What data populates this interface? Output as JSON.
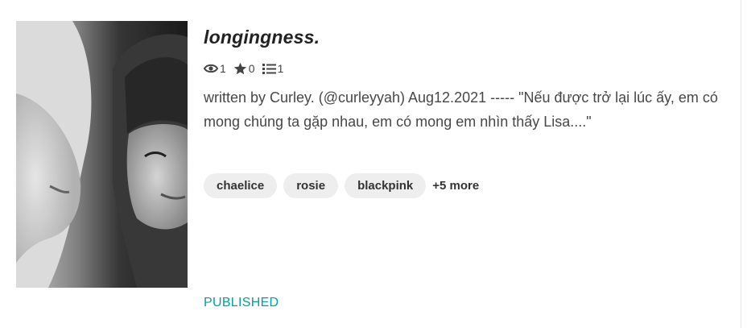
{
  "story": {
    "title": "longingness.",
    "stats": {
      "views": "1",
      "votes": "0",
      "parts": "1",
      "views_icon": "eye-icon",
      "votes_icon": "star-icon",
      "parts_icon": "list-icon"
    },
    "description": "written by Curley. (@curleyyah) Aug12.2021 ----- \"Nếu được trở lại lúc ấy, em có mong chúng ta gặp nhau, em có mong em nhìn thấy Lisa....\"",
    "tags": [
      "chaelice",
      "rosie",
      "blackpink"
    ],
    "more_tags": "+5 more",
    "status": "PUBLISHED"
  },
  "colors": {
    "status": "#00a0a0",
    "tag_bg": "#eeeeee",
    "text": "#474747"
  }
}
